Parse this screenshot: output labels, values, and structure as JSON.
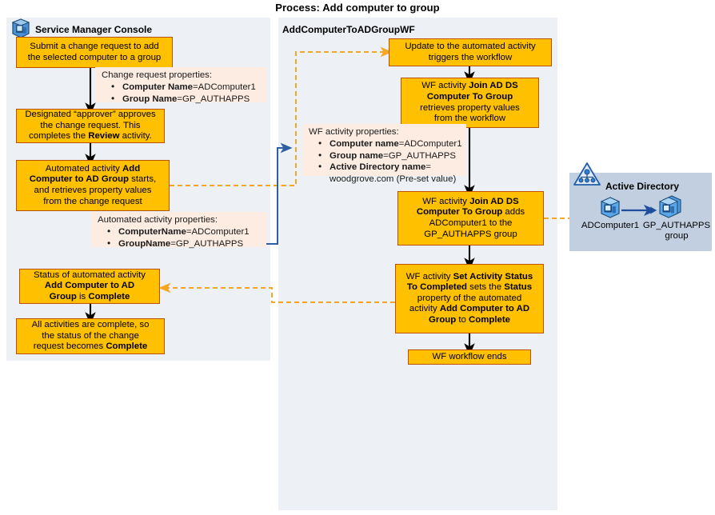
{
  "title": "Process: Add computer to group",
  "lanes": {
    "console": {
      "label": "Service Manager Console",
      "icon": "service-manager-console-icon"
    },
    "workflow": {
      "label": "AddComputerToADGroupWF"
    }
  },
  "console_steps": [
    {
      "id": "submit-change-request",
      "lines": [
        {
          "text": "Submit a change request to add"
        },
        {
          "text": "the selected computer to a group"
        }
      ]
    },
    {
      "id": "approver-approves",
      "lines": [
        {
          "text": "Designated “approver” approves"
        },
        {
          "text": "the change request. This"
        },
        {
          "text": "completes the "
        },
        {
          "text": "Review",
          "bold": true
        },
        {
          "text": " activity."
        }
      ]
    },
    {
      "id": "automated-activity-starts",
      "lines": [
        {
          "text": "Automated activity "
        },
        {
          "text": "Add",
          "bold": true
        },
        {
          "text": "Computer to AD Group",
          "bold": true
        },
        {
          "text": " starts,"
        },
        {
          "text": "and retrieves property values"
        },
        {
          "text": "from the change request"
        }
      ]
    },
    {
      "id": "status-automated-activity-complete",
      "lines": [
        {
          "text": "Status of automated activity"
        },
        {
          "text": "Add Computer to AD",
          "bold": true
        },
        {
          "text": "Group",
          "bold": true
        },
        {
          "text": " is "
        },
        {
          "text": "Complete",
          "bold": true
        }
      ]
    },
    {
      "id": "change-request-complete",
      "lines": [
        {
          "text": "All activities are complete, so"
        },
        {
          "text": "the status of the change"
        },
        {
          "text": "request becomes "
        },
        {
          "text": "Complete",
          "bold": true
        }
      ]
    }
  ],
  "workflow_steps": [
    {
      "id": "update-triggers-workflow",
      "lines": [
        {
          "text": "Update to the automated activity"
        },
        {
          "text": "triggers the workflow"
        }
      ]
    },
    {
      "id": "wf-join-retrieves",
      "lines": [
        {
          "text": "WF activity "
        },
        {
          "text": "Join AD DS",
          "bold": true
        },
        {
          "text": "Computer To Group",
          "bold": true
        },
        {
          "text": "retrieves property values"
        },
        {
          "text": "from the workflow"
        }
      ]
    },
    {
      "id": "wf-join-adds",
      "lines": [
        {
          "text": "WF activity "
        },
        {
          "text": "Join AD DS",
          "bold": true
        },
        {
          "text": "Computer To Group",
          "bold": true
        },
        {
          "text": " adds"
        },
        {
          "text": "ADComputer1 to the"
        },
        {
          "text": "GP_AUTHAPPS group"
        }
      ]
    },
    {
      "id": "wf-set-activity-status",
      "lines": [
        {
          "text": "WF activity "
        },
        {
          "text": "Set Activity Status",
          "bold": true
        },
        {
          "text": "To Completed",
          "bold": true
        },
        {
          "text": " sets the "
        },
        {
          "text": "Status",
          "bold": true
        },
        {
          "text": "property of the automated"
        },
        {
          "text": "activity "
        },
        {
          "text": "Add Computer to AD",
          "bold": true
        },
        {
          "text": "Group",
          "bold": true
        },
        {
          "text": " to "
        },
        {
          "text": "Complete",
          "bold": true
        }
      ]
    },
    {
      "id": "wf-workflow-ends",
      "lines": [
        {
          "text": "WF workflow ends"
        }
      ]
    }
  ],
  "callouts": {
    "change_request": {
      "title": "Change request properties:",
      "items": [
        {
          "name": "Computer Name",
          "value": "=ADComputer1"
        },
        {
          "name": "Group Name",
          "value": "=GP_AUTHAPPS"
        }
      ]
    },
    "automated_activity": {
      "title": "Automated activity properties:",
      "items": [
        {
          "name": "ComputerName",
          "value": "=ADComputer1"
        },
        {
          "name": "GroupName",
          "value": "=GP_AUTHAPPS"
        }
      ]
    },
    "wf_activity": {
      "title": "WF activity properties:",
      "items": [
        {
          "name": "Computer name",
          "value": "=ADComputer1"
        },
        {
          "name": "Group name",
          "value": "=GP_AUTHAPPS"
        },
        {
          "name": "Active Directory name",
          "value": "=",
          "continuation": "woodgrove.com (Pre-set value)"
        }
      ]
    }
  },
  "active_directory": {
    "title": "Active Directory",
    "icon": "active-directory-icon",
    "nodes": [
      {
        "id": "adcomputer1",
        "icon": "computer-icon",
        "label_line1": "ADComputer1",
        "label_line2": ""
      },
      {
        "id": "gp-authapps-group",
        "icon": "computer-group-icon",
        "label_line1": "GP_AUTHAPPS",
        "label_line2": "group"
      }
    ]
  },
  "colors": {
    "box_fill": "#ffc000",
    "box_border": "#c05000",
    "lane_fill": "#edf0f4",
    "callout_fill": "#fcece2",
    "ad_panel_fill": "#c2cfe0",
    "flow_arrow": "#000000",
    "data_arrow": "#f5a623",
    "link_line": "#2e5fa3"
  }
}
